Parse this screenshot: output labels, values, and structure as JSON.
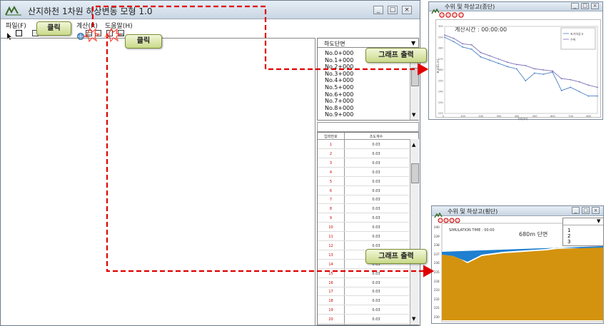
{
  "main_window": {
    "title": "산지하천 1차원 하상변동 모형 1.0",
    "menu": [
      "파일(F)",
      "계산(R)",
      "도움말(H)"
    ],
    "section_header": "하도단면",
    "sections": [
      "No.0+000",
      "No.1+000",
      "No.2+000",
      "No.3+000",
      "No.4+000",
      "No.5+000",
      "No.6+000",
      "No.7+000",
      "No.8+000",
      "No.9+000"
    ],
    "table_headers": [
      "입력번호",
      "조도계수"
    ],
    "table_rows": [
      [
        "1",
        "0.03"
      ],
      [
        "2",
        "0.03"
      ],
      [
        "3",
        "0.03"
      ],
      [
        "4",
        "0.03"
      ],
      [
        "5",
        "0.03"
      ],
      [
        "6",
        "0.03"
      ],
      [
        "7",
        "0.03"
      ],
      [
        "8",
        "0.03"
      ],
      [
        "9",
        "0.03"
      ],
      [
        "10",
        "0.03"
      ],
      [
        "11",
        "0.03"
      ],
      [
        "12",
        "0.03"
      ],
      [
        "13",
        "0.03"
      ],
      [
        "14",
        "0.03"
      ],
      [
        "15",
        "0.03"
      ],
      [
        "16",
        "0.03"
      ],
      [
        "17",
        "0.03"
      ],
      [
        "18",
        "0.03"
      ],
      [
        "19",
        "0.03"
      ],
      [
        "20",
        "0.03"
      ]
    ]
  },
  "callouts": {
    "click1": "클릭",
    "click2": "클릭",
    "graph1": "그래프 출력",
    "graph2": "그래프 출력"
  },
  "longitudinal_window": {
    "title": "수위 및 하상고(종단)",
    "calc_time": "계산시간 : 00:00:00",
    "xlabel": "거리(m)",
    "ylabel": "표고(EL.m)",
    "legend": [
      "초기하상고",
      "수위"
    ],
    "x_ticks": [
      "0",
      "100",
      "200",
      "300",
      "400",
      "500",
      "600",
      "700",
      "800"
    ],
    "y_ticks": [
      "220",
      "230",
      "240",
      "250",
      "260",
      "270",
      "280",
      "290",
      "300"
    ]
  },
  "cross_window": {
    "title": "수위 및 하상고(횡단)",
    "section_label": "680m 단면",
    "sim_label": "SIMULATION TIME : 00:00",
    "dropdown_options": [
      "1",
      "2",
      "3"
    ],
    "y_ticks": [
      "230",
      "231",
      "232",
      "233",
      "234",
      "235",
      "236",
      "237",
      "238",
      "239",
      "240"
    ]
  },
  "colors": {
    "arrow": "#e00000",
    "water": "#1f7fd0",
    "bed": "#d4930e",
    "callout_text": "#222222",
    "row_number": "#cc0000"
  },
  "chart_data": {
    "type": "line",
    "title": "계산시간 : 00:00:00",
    "xlabel": "거리(m)",
    "ylabel": "표고(EL.m)",
    "xlim": [
      0,
      850
    ],
    "ylim": [
      220,
      300
    ],
    "series": [
      {
        "name": "수위",
        "x": [
          0,
          50,
          100,
          150,
          200,
          250,
          300,
          350,
          400,
          450,
          500,
          550,
          600,
          650,
          700,
          750,
          800,
          850
        ],
        "values": [
          292,
          289,
          284,
          283,
          276,
          273,
          270,
          267,
          265,
          264,
          261,
          260,
          259,
          252,
          251,
          249,
          246,
          244
        ]
      },
      {
        "name": "초기하상고",
        "x": [
          0,
          50,
          100,
          150,
          200,
          250,
          300,
          350,
          400,
          450,
          500,
          550,
          600,
          650,
          700,
          750,
          800,
          850
        ],
        "values": [
          290,
          286,
          281,
          279,
          272,
          269,
          266,
          263,
          261,
          250,
          257,
          256,
          258,
          241,
          244,
          240,
          236,
          236
        ]
      }
    ]
  }
}
